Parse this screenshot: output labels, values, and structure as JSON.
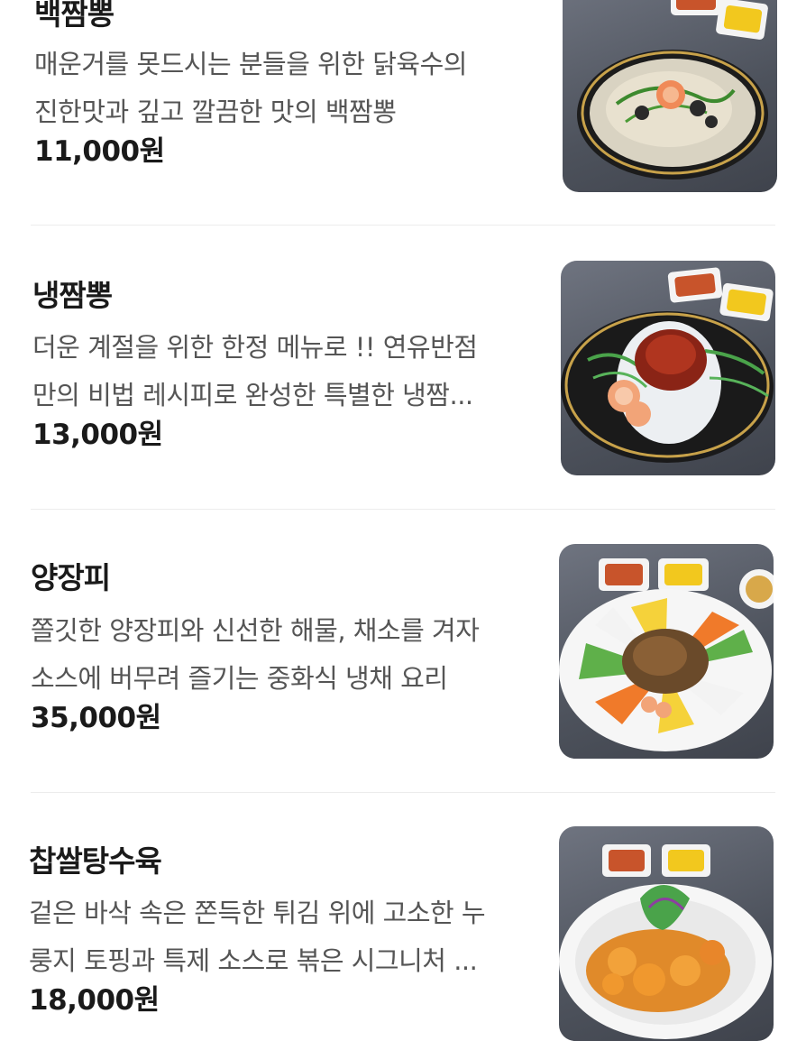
{
  "menu": {
    "items": [
      {
        "name": "백짬뽕",
        "description_lines": [
          "매운거를 못드시는 분들을 위한 닭육수의",
          "진한맛과 깊고 깔끔한 맛의 백짬뽕"
        ],
        "price": "11,000원",
        "photo_icon": "white-seafood-noodle-soup"
      },
      {
        "name": "냉짬뽕",
        "description_lines": [
          "더운 계절을 위한 한정 메뉴로 !! 연유반점",
          "만의 비법 레시피로 완성한 특별한 냉짬..."
        ],
        "price": "13,000원",
        "photo_icon": "cold-noodle-dish"
      },
      {
        "name": "양장피",
        "description_lines": [
          "쫄깃한 양장피와 신선한 해물, 채소를 겨자",
          "소스에 버무려 즐기는 중화식 냉채 요리"
        ],
        "price": "35,000원",
        "photo_icon": "cold-platter-dish"
      },
      {
        "name": "찹쌀탕수육",
        "description_lines": [
          "겉은 바삭 속은 쫀득한 튀김 위에 고소한 누",
          "룽지 토핑과 특제 소스로 볶은 시그니처 ..."
        ],
        "price": "18,000원",
        "photo_icon": "sweet-sour-pork-dish"
      }
    ]
  },
  "colors": {
    "name": "#1a1a1a",
    "description": "#555555",
    "price": "#1a1a1a",
    "divider": "#ececec",
    "photo_background": "#5a5e68"
  }
}
